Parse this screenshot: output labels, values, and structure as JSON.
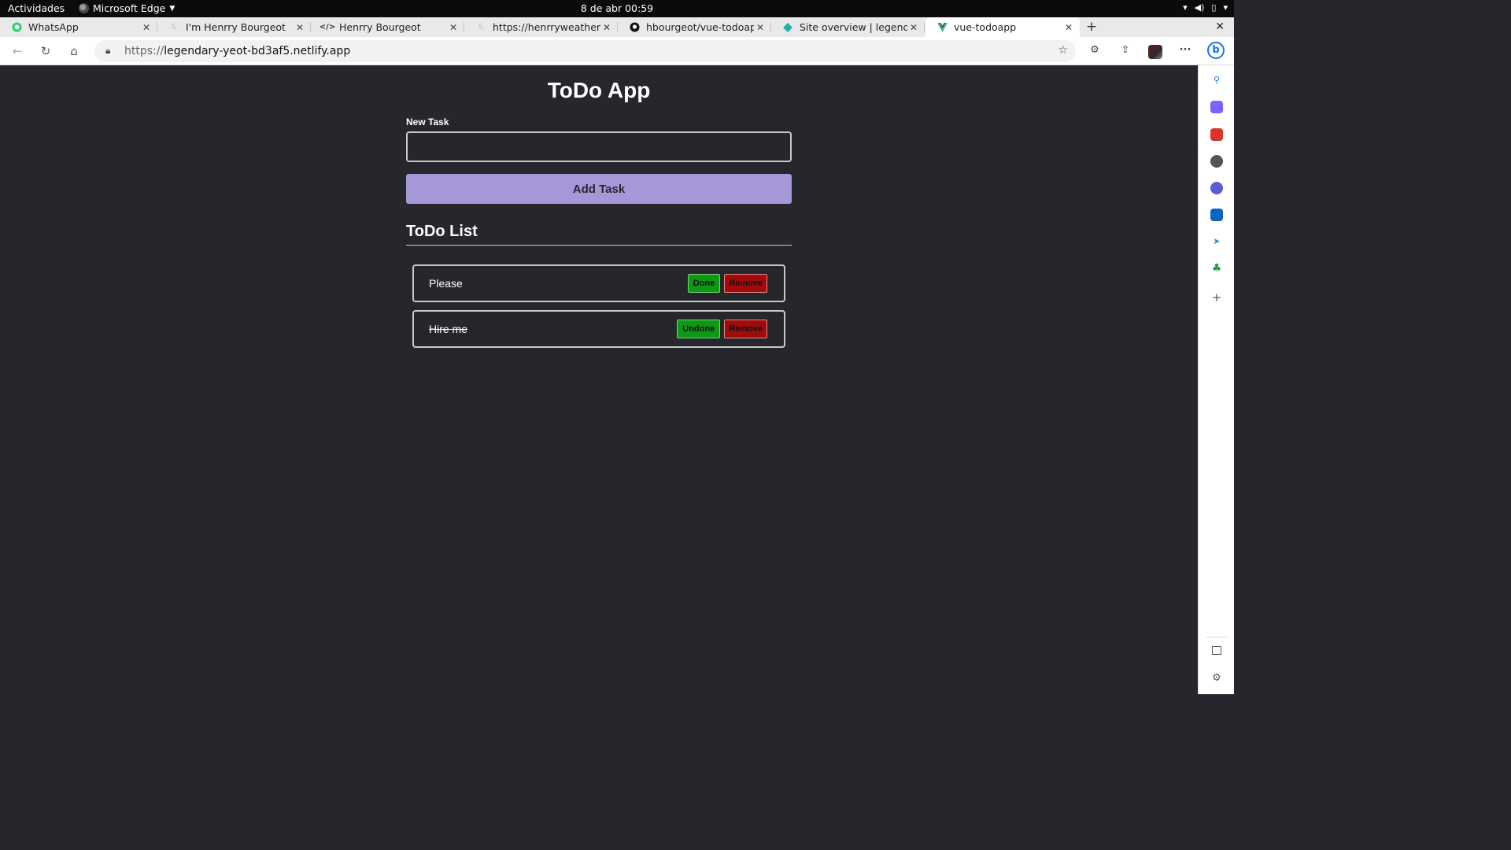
{
  "system": {
    "activities": "Actividades",
    "app_name": "Microsoft Edge",
    "clock": "8 de abr  00:59"
  },
  "browser": {
    "tabs": [
      {
        "title": "WhatsApp",
        "icon": "whatsapp-icon",
        "color": "#25d366"
      },
      {
        "title": "I'm Henrry Bourgeot",
        "icon": "netlify-icon",
        "color": "#bbbbbb"
      },
      {
        "title": "Henrry Bourgeot",
        "icon": "code-icon",
        "color": "#333333"
      },
      {
        "title": "https://henrryweather.ne",
        "icon": "netlify-icon",
        "color": "#bbbbbb"
      },
      {
        "title": "hbourgeot/vue-todoapp",
        "icon": "github-icon",
        "color": "#111111"
      },
      {
        "title": "Site overview | legendary-",
        "icon": "netlify-diamond-icon",
        "color": "#20b2aa"
      },
      {
        "title": "vue-todoapp",
        "icon": "vue-icon",
        "color": "#41b883"
      }
    ],
    "active_tab_index": 6,
    "url_scheme": "https://",
    "url_host": "legendary-yeot-bd3af5.netlify.app"
  },
  "page": {
    "title": "ToDo App",
    "new_task_label": "New Task",
    "new_task_value": "",
    "add_button": "Add Task",
    "list_title": "ToDo List",
    "todos": [
      {
        "text": "Please",
        "completed": false,
        "toggle_label": "Done",
        "remove_label": "Remove"
      },
      {
        "text": "Hire me",
        "completed": true,
        "toggle_label": "Undone",
        "remove_label": "Remove"
      }
    ]
  },
  "colors": {
    "page_bg": "#26272d",
    "accent": "#a697d8",
    "done": "#0c9a14",
    "remove": "#a10b0b"
  }
}
